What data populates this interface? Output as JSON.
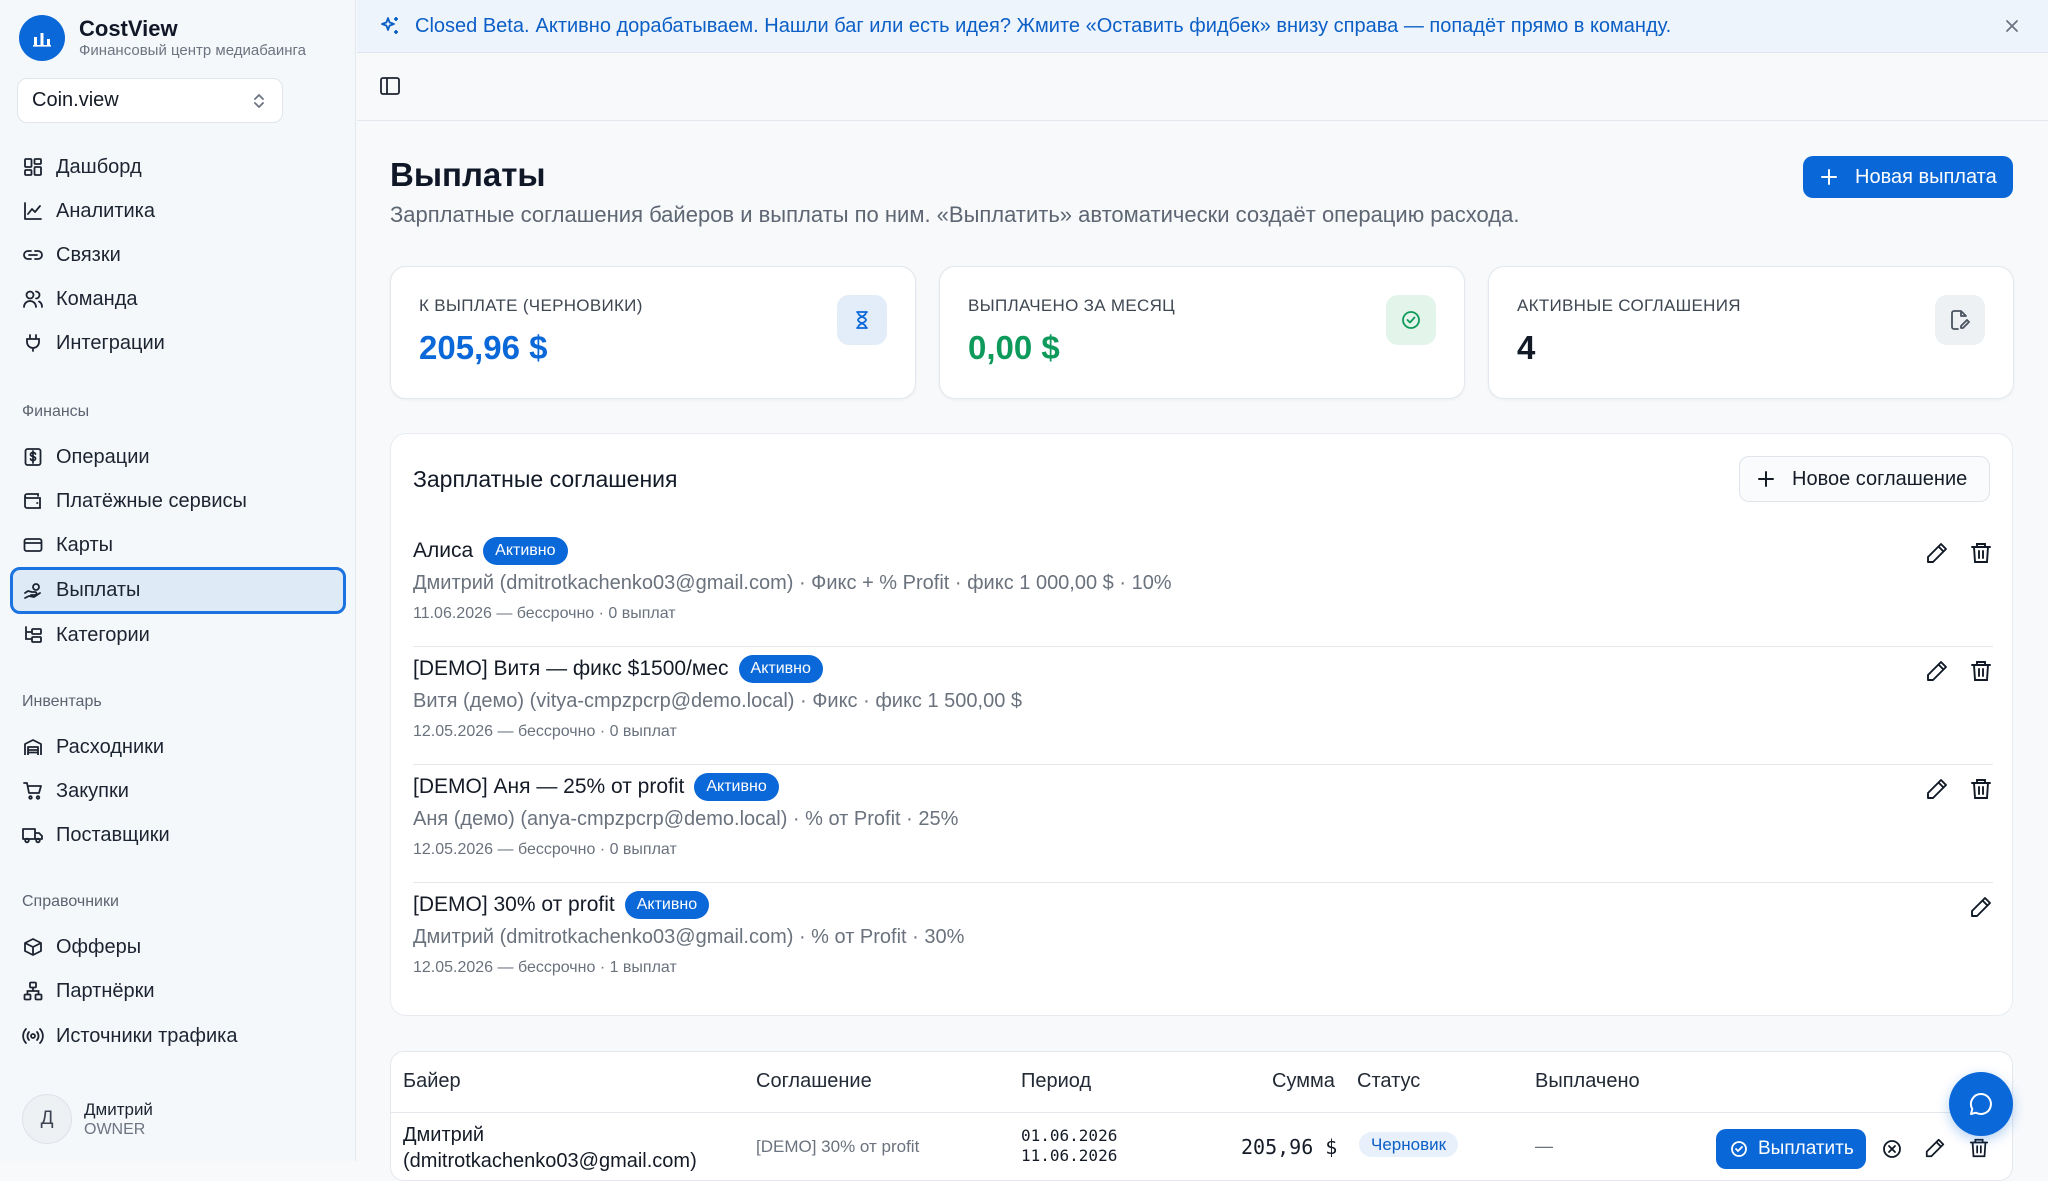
{
  "brand": {
    "title": "CostView",
    "subtitle": "Финансовый центр медиабаинга"
  },
  "workspace": {
    "name": "Coin.view"
  },
  "nav": {
    "main": [
      "Дашборд",
      "Аналитика",
      "Связки",
      "Команда",
      "Интеграции"
    ],
    "finance_section": "Финансы",
    "finance": [
      "Операции",
      "Платёжные сервисы",
      "Карты",
      "Выплаты",
      "Категории"
    ],
    "inventory_section": "Инвентарь",
    "inventory": [
      "Расходники",
      "Закупки",
      "Поставщики"
    ],
    "refs_section": "Справочники",
    "refs": [
      "Офферы",
      "Партнёрки",
      "Источники трафика"
    ],
    "active": "Выплаты"
  },
  "user": {
    "initial": "Д",
    "name": "Дмитрий",
    "role": "OWNER"
  },
  "banner": {
    "strong": "Closed Beta.",
    "text": "Активно дорабатываем. Нашли баг или есть идея? Жмите «Оставить фидбек» внизу справа — попадёт прямо в команду."
  },
  "page": {
    "title": "Выплаты",
    "subtitle": "Зарплатные соглашения байеров и выплаты по ним. «Выплатить» автоматически создаёт операцию расхода.",
    "new_payout": "Новая выплата"
  },
  "cards": [
    {
      "label": "К ВЫПЛАТЕ (ЧЕРНОВИКИ)",
      "value": "205,96 $",
      "color": "#0b68d8"
    },
    {
      "label": "ВЫПЛАЧЕНО ЗА МЕСЯЦ",
      "value": "0,00 $",
      "color": "#0e9a5a"
    },
    {
      "label": "АКТИВНЫЕ СОГЛАШЕНИЯ",
      "value": "4",
      "color": "#111a26"
    }
  ],
  "agreements": {
    "title": "Зарплатные соглашения",
    "new_button": "Новое соглашение",
    "items": [
      {
        "name": "Алиса",
        "status": "Активно",
        "desc": "Дмитрий (dmitrotkachenko03@gmail.com) · Фикс + % Profit · фикс 1 000,00 $ · 10%",
        "meta": "11.06.2026 — бессрочно · 0 выплат"
      },
      {
        "name": "[DEMO] Витя — фикс $1500/мес",
        "status": "Активно",
        "desc": "Витя (демо) (vitya-cmpzpcrp@demo.local) · Фикс · фикс 1 500,00 $",
        "meta": "12.05.2026 — бессрочно · 0 выплат"
      },
      {
        "name": "[DEMO] Аня — 25% от profit",
        "status": "Активно",
        "desc": "Аня (демо) (anya-cmpzpcrp@demo.local) · % от Profit · 25%",
        "meta": "12.05.2026 — бессрочно · 0 выплат"
      },
      {
        "name": "[DEMO] 30% от profit",
        "status": "Активно",
        "desc": "Дмитрий (dmitrotkachenko03@gmail.com) · % от Profit · 30%",
        "meta": "12.05.2026 — бессрочно · 1 выплат"
      }
    ]
  },
  "payouts": {
    "headers": [
      "Байер",
      "Соглашение",
      "Период",
      "Сумма",
      "Статус",
      "Выплачено"
    ],
    "row": {
      "buyer_name": "Дмитрий",
      "buyer_email": "(dmitrotkachenko03@gmail.com)",
      "agreement": "[DEMO] 30% от profit",
      "period_start": "01.06.2026",
      "period_end": "11.06.2026",
      "amount": "205,96 $",
      "status": "Черновик",
      "paid": "—",
      "pay_button": "Выплатить"
    }
  }
}
